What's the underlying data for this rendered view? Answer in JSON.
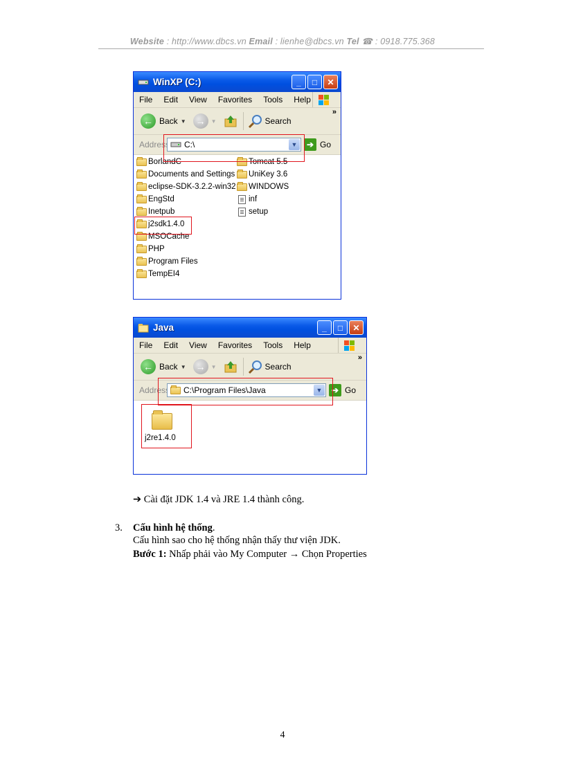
{
  "header": {
    "website_label": "Website",
    "website_value": " : http://www.dbcs.vn ",
    "email_label": "Email",
    "email_value": " : lienhe@dbcs.vn ",
    "tel_label": "Tel",
    "tel_value": " : 0918.775.368",
    "phone_icon": "phone-icon"
  },
  "window1": {
    "title": "WinXP (C:)",
    "menu": [
      "File",
      "Edit",
      "View",
      "Favorites",
      "Tools",
      "Help"
    ],
    "back_label": "Back",
    "search_label": "Search",
    "address_label": "Address",
    "address_value": "C:\\",
    "go_label": "Go",
    "folders_col1": [
      "BorlandC",
      "Documents and Settings",
      "eclipse-SDK-3.2.2-win32",
      "EngStd",
      "Inetpub",
      "j2sdk1.4.0",
      "MSOCache",
      "PHP",
      "Program Files",
      "TempEI4"
    ],
    "folders_col2": [
      "Tomcat 5.5",
      "UniKey 3.6",
      "WINDOWS"
    ],
    "files_col2": [
      "inf",
      "setup"
    ]
  },
  "window2": {
    "title": "Java",
    "menu": [
      "File",
      "Edit",
      "View",
      "Favorites",
      "Tools",
      "Help"
    ],
    "back_label": "Back",
    "search_label": "Search",
    "address_label": "Address",
    "address_value": "C:\\Program Files\\Java",
    "go_label": "Go",
    "folder": "j2re1.4.0"
  },
  "body": {
    "arrow1": "➔",
    "result_line": "Cài đặt JDK 1.4 và JRE 1.4 thành công.",
    "section_number": "3.",
    "section_title": "Cấu hình hệ thống",
    "section_title_end": ".",
    "section_desc": "Cấu hình sao cho hệ thống nhận thấy thư viện JDK.",
    "step_label": "Bước 1:",
    "step_text": " Nhấp phải vào My Computer ",
    "arrow2": "→",
    "step_text2": " Chọn Properties"
  },
  "page_number": "4"
}
